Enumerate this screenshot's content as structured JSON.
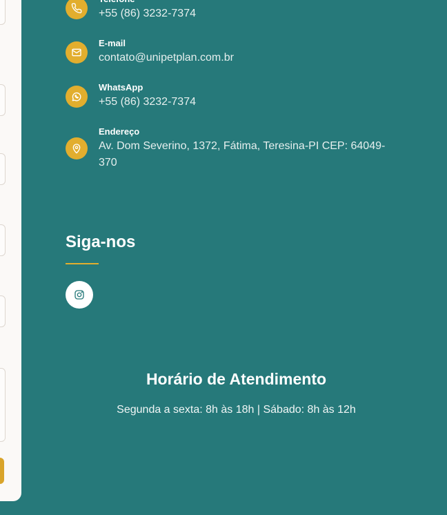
{
  "contacts": [
    {
      "label": "Telefone",
      "value": "+55 (86) 3232-7374",
      "icon": "phone-icon"
    },
    {
      "label": "E-mail",
      "value": "contato@unipetplan.com.br",
      "icon": "mail-icon"
    },
    {
      "label": "WhatsApp",
      "value": "+55 (86) 3232-7374",
      "icon": "whatsapp-icon"
    },
    {
      "label": "Endereço",
      "value_line1": "Av. Dom Severino, 1372, Fátima, Teresina-PI CEP: 64049-",
      "value_line2": "370",
      "icon": "map-pin-icon"
    }
  ],
  "social": {
    "title": "Siga-nos",
    "icon": "instagram-icon"
  },
  "hours": {
    "title": "Horário de Atendimento",
    "text": "Segunda a sexta: 8h às 18h | Sábado: 8h às 12h"
  },
  "colors": {
    "background": "#26797a",
    "accent": "#e2ae2e",
    "panel": "#fbf9f7"
  }
}
